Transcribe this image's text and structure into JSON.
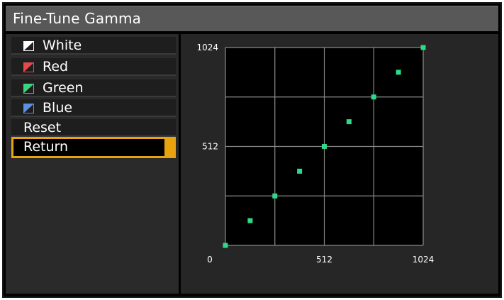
{
  "window": {
    "title": "Fine-Tune Gamma"
  },
  "menu": {
    "items": [
      {
        "label": "White",
        "icon": "gamma-curve-icon",
        "icon_color": "#ffffff"
      },
      {
        "label": "Red",
        "icon": "gamma-curve-icon",
        "icon_color": "#e34a4a"
      },
      {
        "label": "Green",
        "icon": "gamma-curve-icon",
        "icon_color": "#3fd27e"
      },
      {
        "label": "Blue",
        "icon": "gamma-curve-icon",
        "icon_color": "#5f8fe0"
      },
      {
        "label": "Reset"
      },
      {
        "label": "Return",
        "selected": true
      }
    ],
    "selection_color": "#e9a30f"
  },
  "chart_data": {
    "type": "scatter",
    "title": "",
    "xlabel": "",
    "ylabel": "",
    "xlim": [
      0,
      1024
    ],
    "ylim": [
      0,
      1024
    ],
    "x_ticks": [
      "0",
      "512",
      "1024"
    ],
    "y_ticks": [
      "512",
      "1024"
    ],
    "grid": true,
    "point_color": "#2fd987",
    "points": [
      {
        "x": 0,
        "y": 0
      },
      {
        "x": 128,
        "y": 128
      },
      {
        "x": 256,
        "y": 256
      },
      {
        "x": 384,
        "y": 384
      },
      {
        "x": 512,
        "y": 512
      },
      {
        "x": 640,
        "y": 640
      },
      {
        "x": 768,
        "y": 768
      },
      {
        "x": 896,
        "y": 896
      },
      {
        "x": 1024,
        "y": 1024
      }
    ]
  }
}
